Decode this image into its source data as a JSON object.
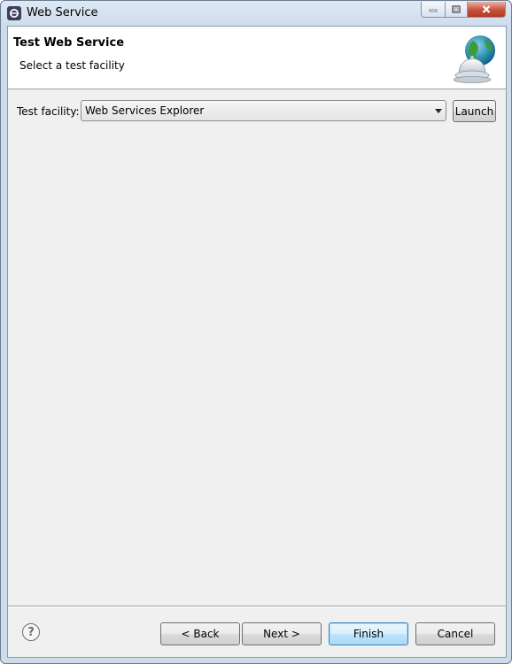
{
  "window": {
    "title": "Web Service",
    "controls": {
      "minimize_icon": "minimize-icon",
      "maximize_icon": "maximize-icon",
      "close_icon": "close-icon"
    }
  },
  "banner": {
    "title": "Test Web Service",
    "subtitle": "Select a test facility",
    "icon": "globe-service-bell-icon"
  },
  "form": {
    "test_facility_label": "Test facility:",
    "test_facility_value": "Web Services Explorer",
    "launch_label": "Launch"
  },
  "footer": {
    "help_symbol": "?",
    "back_label": "< Back",
    "next_label": "Next >",
    "finish_label": "Finish",
    "cancel_label": "Cancel"
  },
  "colors": {
    "frame": "#cddbeb",
    "client_background": "#f0f0f0",
    "banner_background": "#ffffff",
    "default_button": "#bee6fd"
  }
}
